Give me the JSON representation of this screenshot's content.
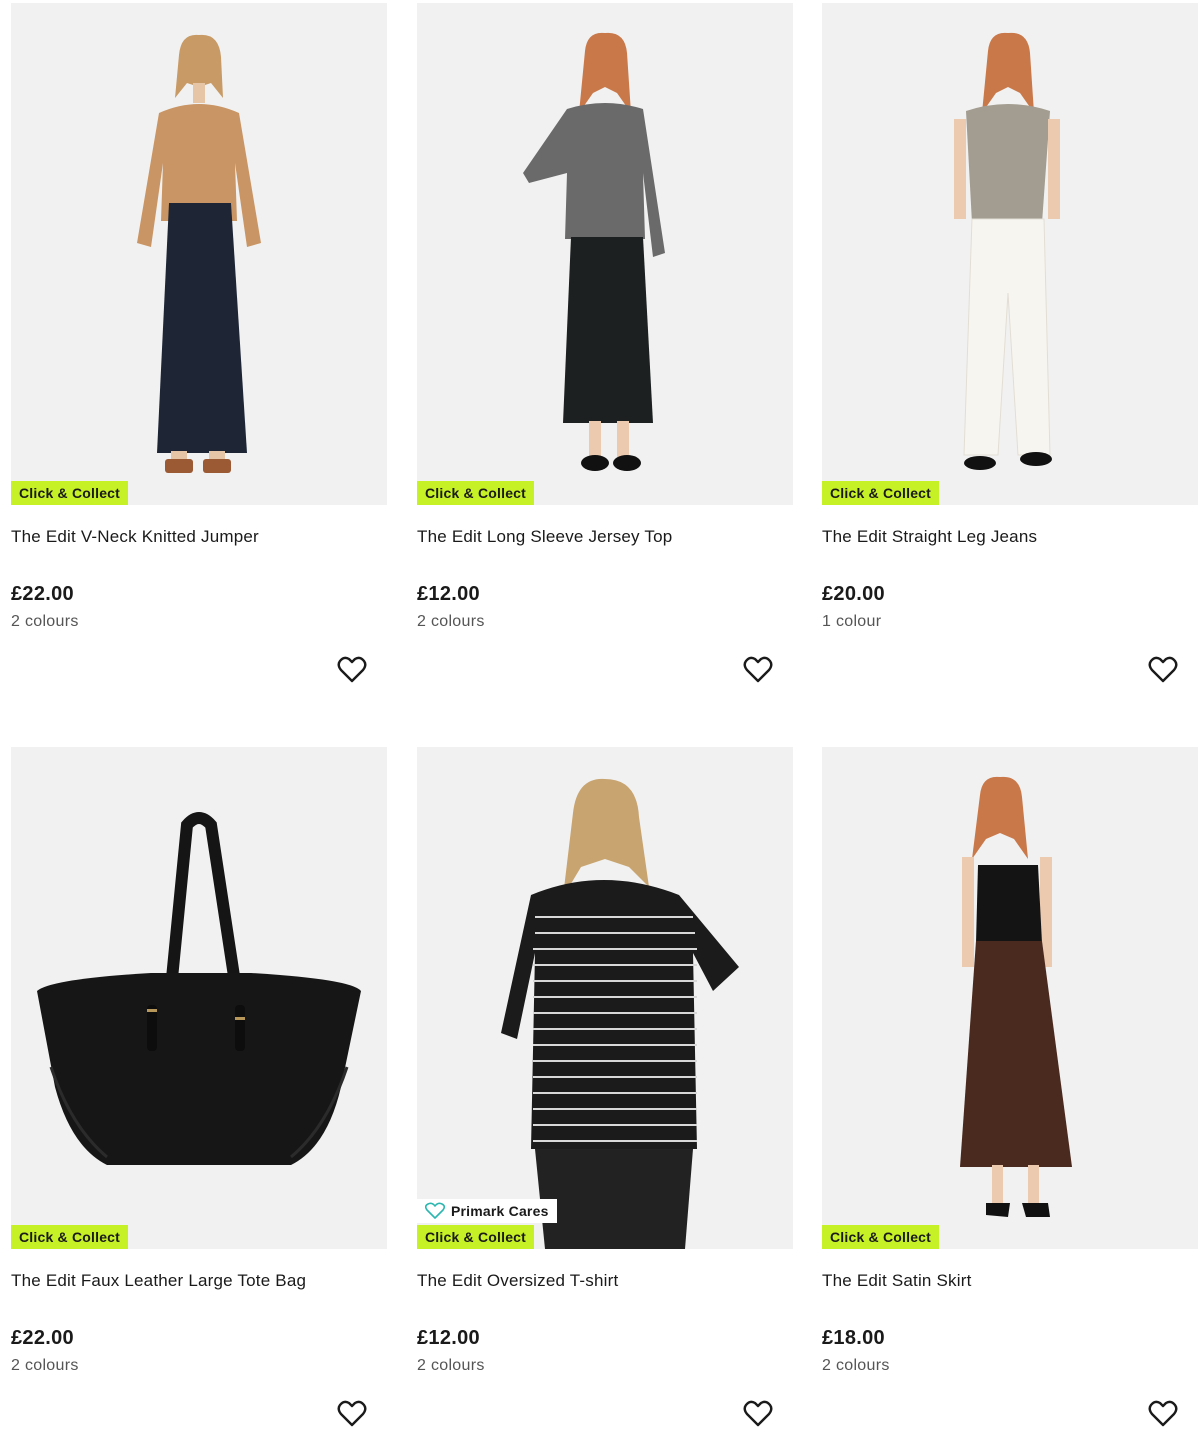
{
  "colors": {
    "accent_badge": "#c6f126",
    "image_bg": "#f1f1f1",
    "text": "#1a1a1a",
    "muted": "#555555",
    "cares_icon": "#2bb7b0"
  },
  "products": [
    {
      "title": "The Edit V-Neck Knitted Jumper",
      "price": "£22.00",
      "colours": "2 colours",
      "badge": "Click & Collect",
      "image": "woman-beige-jumper-denim-skirt",
      "favourite_icon": "heart-outline-icon"
    },
    {
      "title": "The Edit Long Sleeve Jersey Top",
      "price": "£12.00",
      "colours": "2 colours",
      "badge": "Click & Collect",
      "image": "woman-grey-top-black-skirt",
      "favourite_icon": "heart-outline-icon"
    },
    {
      "title": "The Edit Straight Leg Jeans",
      "price": "£20.00",
      "colours": "1 colour",
      "badge": "Click & Collect",
      "image": "woman-taupe-top-white-jeans",
      "favourite_icon": "heart-outline-icon"
    },
    {
      "title": "The Edit Faux Leather Large Tote Bag",
      "price": "£22.00",
      "colours": "2 colours",
      "badge": "Click & Collect",
      "image": "black-tote-bag",
      "favourite_icon": "heart-outline-icon"
    },
    {
      "title": "The Edit Oversized T-shirt",
      "price": "£12.00",
      "colours": "2 colours",
      "badge": "Click & Collect",
      "badge_secondary": "Primark Cares",
      "image": "woman-striped-tshirt",
      "favourite_icon": "heart-outline-icon"
    },
    {
      "title": "The Edit Satin Skirt",
      "price": "£18.00",
      "colours": "2 colours",
      "badge": "Click & Collect",
      "image": "woman-black-cami-brown-skirt",
      "favourite_icon": "heart-outline-icon"
    }
  ]
}
